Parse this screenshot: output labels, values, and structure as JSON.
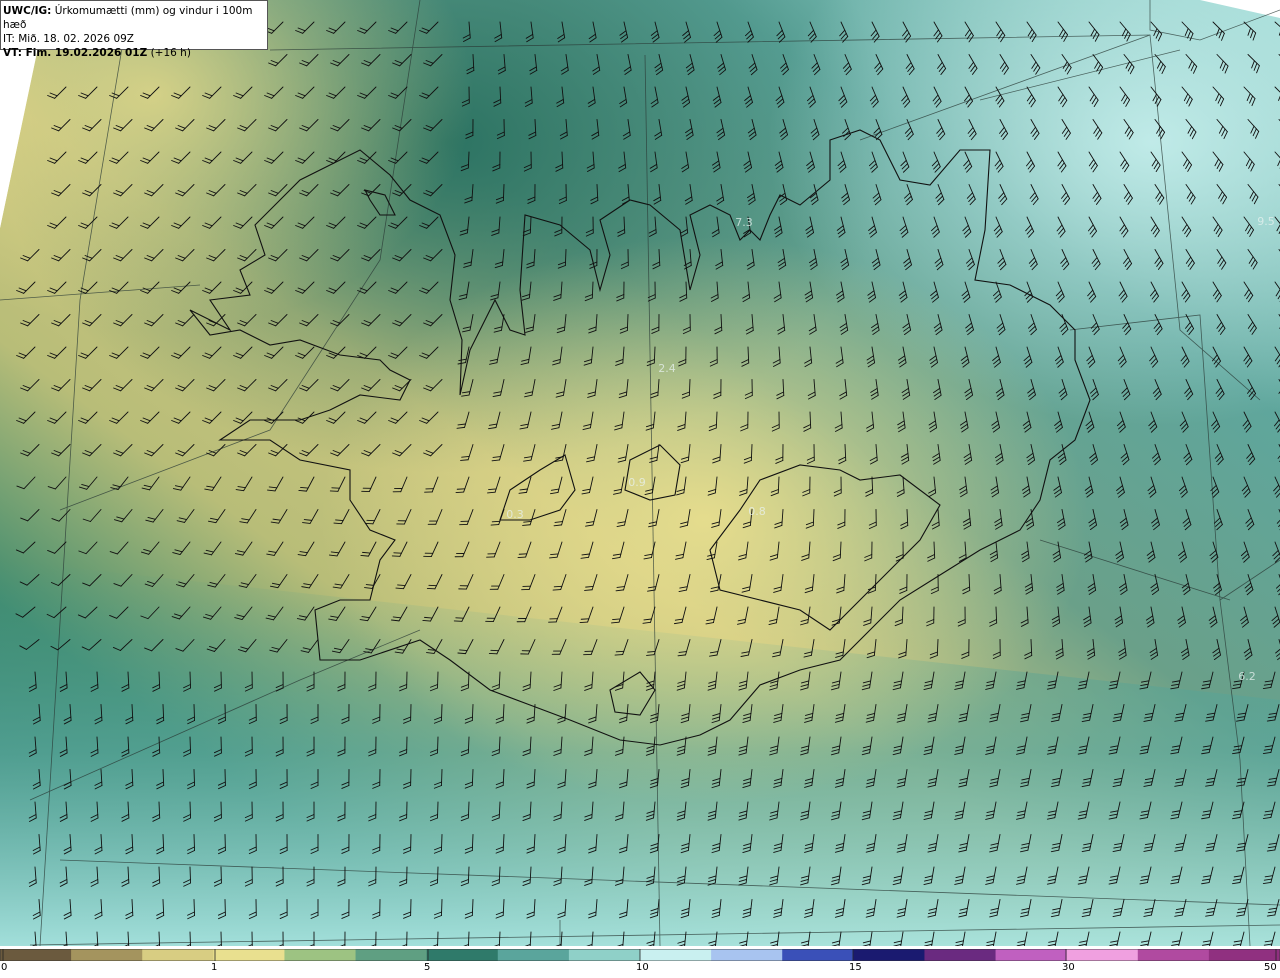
{
  "header": {
    "model_label": "UWC/IG:",
    "title": "Úrkomumætti (mm) og vindur i 100m hæð",
    "init_time": "IT: Mið. 18. 02. 2026 09Z",
    "valid_label": "VT: Fim. 19.02.2026 01Z",
    "lead_time": "(+16 h)"
  },
  "colorbar": {
    "ticks": [
      {
        "label": "0",
        "value": 0
      },
      {
        "label": "1",
        "value": 1
      },
      {
        "label": "5",
        "value": 5
      },
      {
        "label": "10",
        "value": 10
      },
      {
        "label": "15",
        "value": 15
      },
      {
        "label": "30",
        "value": 30
      },
      {
        "label": "50",
        "value": 50
      }
    ],
    "colors": [
      "#6b5a3e",
      "#a4945e",
      "#d8cd82",
      "#e9e08f",
      "#9dc382",
      "#5f9f82",
      "#2f7a6a",
      "#5aa59c",
      "#8fd0c8",
      "#c9f0f0",
      "#a8c4f0",
      "#3a50b8",
      "#1a1a70",
      "#6a2a80",
      "#c060c0",
      "#f0a0e0",
      "#b04aa0",
      "#903080"
    ]
  },
  "map_labels": [
    {
      "text": "7.3"
    },
    {
      "text": "2.4"
    },
    {
      "text": "0.9"
    },
    {
      "text": "0.8"
    },
    {
      "text": "0.3"
    },
    {
      "text": "9.5"
    },
    {
      "text": "6.2"
    }
  ]
}
